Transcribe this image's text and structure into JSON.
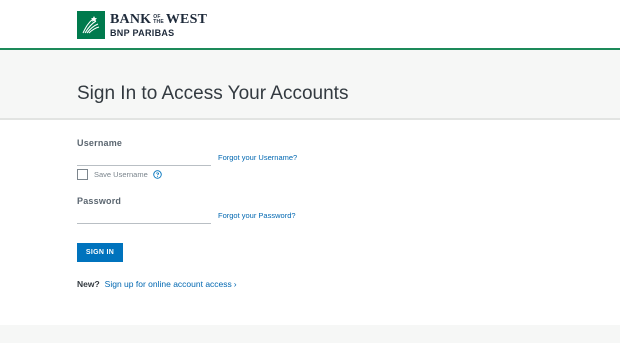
{
  "brand": {
    "line1_left": "BANK",
    "line1_of": "OF",
    "line1_the": "THE",
    "line1_right": "WEST",
    "line2": "BNP PARIBAS",
    "mark_icon": "bank-logo-mark-icon",
    "color": "#007a4d"
  },
  "title": "Sign In to Access Your Accounts",
  "form": {
    "username_label": "Username",
    "username_value": "",
    "forgot_username": "Forgot your Username?",
    "save_username_label": "Save Username",
    "save_username_checked": false,
    "help_icon": "question-circle-icon",
    "password_label": "Password",
    "password_value": "",
    "forgot_password": "Forgot your Password?",
    "signin_label": "SIGN IN",
    "new_label": "New?",
    "signup_link": "Sign up for online account access",
    "signup_arrow": "›"
  },
  "colors": {
    "accent": "#0073bd",
    "link": "#0067b1",
    "header_rule": "#1d8a5a"
  }
}
